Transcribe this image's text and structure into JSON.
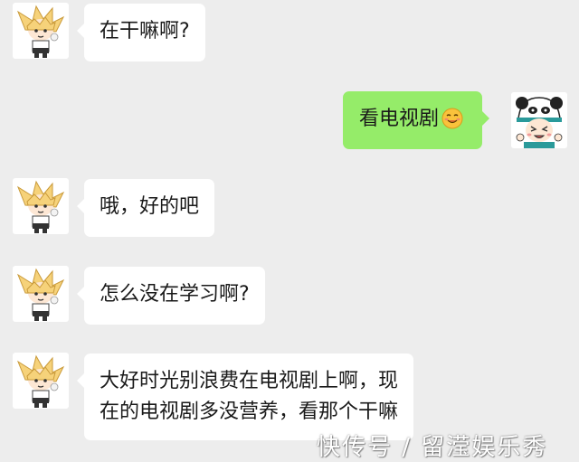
{
  "chat": {
    "messages": [
      {
        "side": "left",
        "text": "在干嘛啊?"
      },
      {
        "side": "right",
        "text": "看电视剧",
        "emoji": "smiling-face-emoji"
      },
      {
        "side": "left",
        "text": "哦，好的吧"
      },
      {
        "side": "left",
        "text": "怎么没在学习啊?"
      },
      {
        "side": "left",
        "lines": [
          "大好时光别浪费在电视剧上啊，现",
          "在的电视剧多没营养，看那个干嘛"
        ]
      }
    ]
  },
  "avatars": {
    "left": "blonde-cartoon-boy-avatar",
    "right": "panda-hat-boy-avatar"
  },
  "watermark": {
    "text": "快传号 / 留滢娱乐秀"
  },
  "colors": {
    "background": "#ededed",
    "left_bubble": "#ffffff",
    "right_bubble": "#95ec69"
  }
}
